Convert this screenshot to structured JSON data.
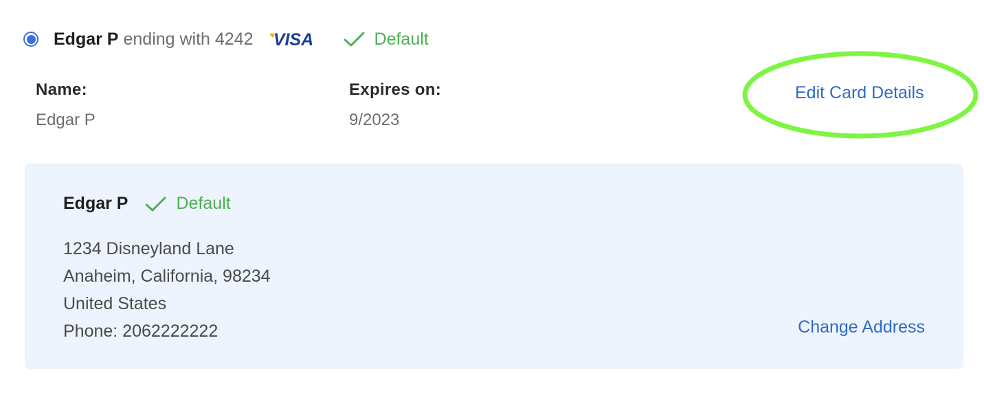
{
  "card": {
    "holder_name": "Edgar P",
    "ending_text": "ending with 4242",
    "brand": "VISA",
    "default_label": "Default",
    "name_label": "Name:",
    "name_value": "Edgar P",
    "expires_label": "Expires on:",
    "expires_value": "9/2023",
    "edit_link": "Edit Card Details",
    "selected": true
  },
  "address": {
    "name": "Edgar P",
    "default_label": "Default",
    "line1": "1234 Disneyland Lane",
    "line2": "Anaheim, California, 98234",
    "line3": "United States",
    "phone": "Phone: 2062222222",
    "change_link": "Change Address"
  },
  "colors": {
    "accent_blue": "#2f6bc6",
    "radio_blue": "#3b6fe0",
    "default_green": "#4caf50",
    "highlight_green": "#7ef542",
    "address_bg": "#eef4fd",
    "visa_blue": "#1a3f95",
    "visa_gold": "#f5a623"
  },
  "icons": {
    "radio": "radio-selected-icon",
    "brand": "visa-logo-icon",
    "check": "check-icon"
  }
}
